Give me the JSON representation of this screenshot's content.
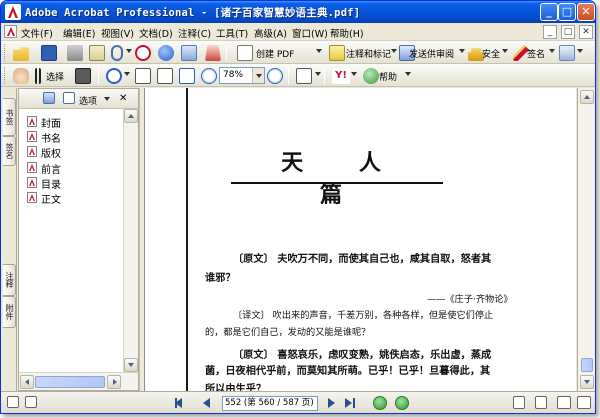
{
  "window": {
    "app_name": "Adobe Acrobat Professional",
    "title": "Adobe Acrobat Professional - [诸子百家智慧妙语主典.pdf]",
    "minimize_label": "_",
    "maximize_label": "□",
    "close_label": "✕",
    "title_color": "#0854d8"
  },
  "menubar": {
    "items": [
      {
        "label": "文件(F)",
        "icon": "file-menu"
      },
      {
        "label": "编辑(E)",
        "icon": "edit-menu"
      },
      {
        "label": "视图(V)",
        "icon": "view-menu"
      },
      {
        "label": "文档(D)",
        "icon": "document-menu"
      },
      {
        "label": "注释(C)",
        "icon": "comments-menu"
      },
      {
        "label": "工具(T)",
        "icon": "tools-menu"
      },
      {
        "label": "高级(A)",
        "icon": "advanced-menu"
      },
      {
        "label": "窗口(W)",
        "icon": "window-menu"
      },
      {
        "label": "帮助(H)",
        "icon": "help-menu"
      }
    ],
    "mdi_minimize": "_",
    "mdi_restore": "□",
    "mdi_close": "✕"
  },
  "toolbar1": {
    "create_pdf": "创建 PDF",
    "comment_markup": "注释和标记",
    "send_review": "发送供审阅",
    "secure": "安全",
    "sign": "签名",
    "icons": [
      "open-folder-icon",
      "save-icon",
      "print-icon",
      "email-icon",
      "attach-icon",
      "search-icon",
      "organizer-icon",
      "upload-icon",
      "acrobat-icon"
    ]
  },
  "toolbar2": {
    "select_label": "选择",
    "zoom_value": "78%",
    "help_label": "帮助",
    "icons": [
      "hand-icon",
      "select-text-icon",
      "snapshot-icon",
      "zoom-in-icon",
      "actual-size-icon",
      "fit-page-icon",
      "fit-width-icon",
      "zoom-out-icon",
      "zoom-plus-icon",
      "page-layout-icon",
      "adobe-logo-icon",
      "help-icon"
    ]
  },
  "left_tabs": [
    "书签",
    "签名",
    "注释",
    "附件"
  ],
  "nav_panel": {
    "options_label": "选项",
    "close_label": "✕",
    "bookmarks": [
      "封面",
      "书名",
      "版权",
      "前言",
      "目录",
      "正文"
    ]
  },
  "document": {
    "page_title": "天 人 篇",
    "lines": [
      {
        "text": "〔原文〕  夫吹万不同，而使其自己也，咸其自取，怒者其",
        "style": "lg"
      },
      {
        "text": "谁邪？",
        "style": "lg"
      },
      {
        "text": "——《庄子·齐物论》",
        "style": "sm"
      },
      {
        "text": "〔译文〕  吹出来的声音，千差万别，各种各样，但是使它们停止",
        "style": "sm"
      },
      {
        "text": "的，都是它们自己，发动的又能是谁呢？",
        "style": "sm"
      },
      {
        "text": "〔原文〕  喜怒哀乐，虑叹变熟，姚佚启态，乐出虚，蒸成",
        "style": "lg"
      },
      {
        "text": "菌，日夜相代乎前，而莫知其所萌。已乎！已乎！旦暮得此，其",
        "style": "lg"
      },
      {
        "text": "所以由生乎？",
        "style": "lg"
      }
    ]
  },
  "statusbar": {
    "page_field": "552 (第 560 / 587 页)",
    "total_pages": 587,
    "current_page": 560
  }
}
